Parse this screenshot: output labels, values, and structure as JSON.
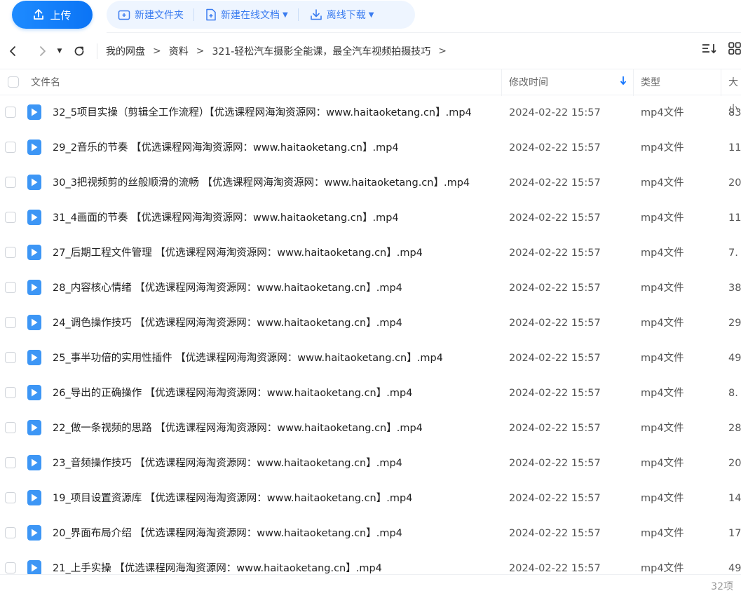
{
  "toolbar": {
    "upload_label": "上传",
    "new_folder_label": "新建文件夹",
    "new_online_doc_label": "新建在线文档",
    "offline_download_label": "离线下载"
  },
  "breadcrumb": [
    "我的网盘",
    "资料",
    "321-轻松汽车摄影全能课，最全汽车视频拍摄技巧"
  ],
  "columns": {
    "name": "文件名",
    "modified": "修改时间",
    "type": "类型",
    "size": "大小"
  },
  "files": [
    {
      "name": "32_5项目实操（剪辑全工作流程）【优选课程网海淘资源网：www.haitaoketang.cn】.mp4",
      "modified": "2024-02-22 15:57",
      "type": "mp4文件",
      "size": "83"
    },
    {
      "name": "29_2音乐的节奏 【优选课程网海淘资源网：www.haitaoketang.cn】.mp4",
      "modified": "2024-02-22 15:57",
      "type": "mp4文件",
      "size": "11"
    },
    {
      "name": "30_3把视频剪的丝般顺滑的流畅 【优选课程网海淘资源网：www.haitaoketang.cn】.mp4",
      "modified": "2024-02-22 15:57",
      "type": "mp4文件",
      "size": "20"
    },
    {
      "name": "31_4画面的节奏 【优选课程网海淘资源网：www.haitaoketang.cn】.mp4",
      "modified": "2024-02-22 15:57",
      "type": "mp4文件",
      "size": "11"
    },
    {
      "name": "27_后期工程文件管理 【优选课程网海淘资源网：www.haitaoketang.cn】.mp4",
      "modified": "2024-02-22 15:57",
      "type": "mp4文件",
      "size": "7."
    },
    {
      "name": "28_内容核心情绪 【优选课程网海淘资源网：www.haitaoketang.cn】.mp4",
      "modified": "2024-02-22 15:57",
      "type": "mp4文件",
      "size": "38"
    },
    {
      "name": "24_调色操作技巧 【优选课程网海淘资源网：www.haitaoketang.cn】.mp4",
      "modified": "2024-02-22 15:57",
      "type": "mp4文件",
      "size": "29"
    },
    {
      "name": "25_事半功倍的实用性插件 【优选课程网海淘资源网：www.haitaoketang.cn】.mp4",
      "modified": "2024-02-22 15:57",
      "type": "mp4文件",
      "size": "49"
    },
    {
      "name": "26_导出的正确操作 【优选课程网海淘资源网：www.haitaoketang.cn】.mp4",
      "modified": "2024-02-22 15:57",
      "type": "mp4文件",
      "size": "8."
    },
    {
      "name": "22_做一条视频的思路 【优选课程网海淘资源网：www.haitaoketang.cn】.mp4",
      "modified": "2024-02-22 15:57",
      "type": "mp4文件",
      "size": "28"
    },
    {
      "name": "23_音频操作技巧 【优选课程网海淘资源网：www.haitaoketang.cn】.mp4",
      "modified": "2024-02-22 15:57",
      "type": "mp4文件",
      "size": "20"
    },
    {
      "name": "19_项目设置资源库 【优选课程网海淘资源网：www.haitaoketang.cn】.mp4",
      "modified": "2024-02-22 15:57",
      "type": "mp4文件",
      "size": "14"
    },
    {
      "name": "20_界面布局介绍 【优选课程网海淘资源网：www.haitaoketang.cn】.mp4",
      "modified": "2024-02-22 15:57",
      "type": "mp4文件",
      "size": "17"
    },
    {
      "name": "21_上手实操 【优选课程网海淘资源网：www.haitaoketang.cn】.mp4",
      "modified": "2024-02-22 15:57",
      "type": "mp4文件",
      "size": "49"
    }
  ],
  "footer": {
    "count": "32项"
  },
  "colors": {
    "accent": "#0b74f5",
    "toolbar_bg": "#eef5ff",
    "file_icon": "#3d96f5"
  },
  "icons": [
    "upload-icon",
    "new-folder-icon",
    "new-doc-icon",
    "download-icon",
    "back-icon",
    "forward-icon",
    "refresh-icon",
    "sort-icon",
    "grid-view-icon",
    "play-file-icon"
  ]
}
